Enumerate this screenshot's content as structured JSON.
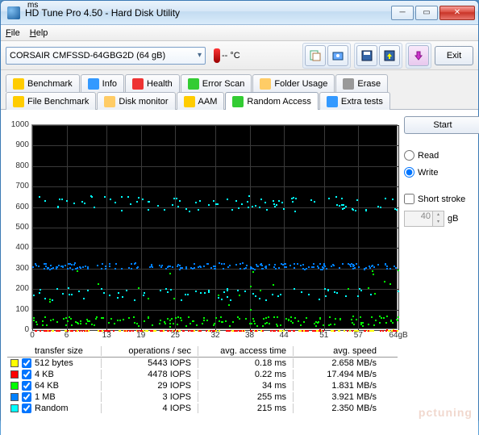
{
  "window": {
    "title": "HD Tune Pro 4.50 - Hard Disk Utility"
  },
  "menu": {
    "file": "File",
    "help": "Help"
  },
  "toolbar": {
    "device": "CORSAIR CMFSSD-64GBG2D (64 gB)",
    "temp_label": "-- °C",
    "exit": "Exit"
  },
  "tabs": {
    "row1": [
      "Benchmark",
      "Info",
      "Health",
      "Error Scan",
      "Folder Usage",
      "Erase"
    ],
    "row2": [
      "File Benchmark",
      "Disk monitor",
      "AAM",
      "Random Access",
      "Extra tests"
    ],
    "active": "Random Access"
  },
  "controls": {
    "start": "Start",
    "read": "Read",
    "write": "Write",
    "short_stroke": "Short stroke",
    "stroke_value": "40",
    "stroke_unit": "gB"
  },
  "chart_data": {
    "type": "scatter",
    "title": "",
    "xlabel": "gB",
    "ylabel": "ms",
    "xlim": [
      0,
      64
    ],
    "ylim": [
      0,
      1000
    ],
    "xticks": [
      0,
      6,
      13,
      19,
      25,
      32,
      38,
      44,
      51,
      57,
      "64gB"
    ],
    "yticks": [
      0,
      100,
      200,
      300,
      400,
      500,
      600,
      700,
      800,
      900,
      1000
    ],
    "series": [
      {
        "name": "512 bytes",
        "color": "#ffff00",
        "band_ms": [
          0,
          2
        ]
      },
      {
        "name": "4 KB",
        "color": "#ff0000",
        "band_ms": [
          0,
          2
        ]
      },
      {
        "name": "64 KB",
        "color": "#00ff00",
        "band_ms": [
          20,
          70
        ]
      },
      {
        "name": "1 MB",
        "color": "#0080ff",
        "band_ms": [
          300,
          330
        ]
      },
      {
        "name": "Random",
        "color": "#00ffff",
        "band_ms": [
          150,
          640
        ]
      }
    ]
  },
  "table": {
    "headers": {
      "size": "transfer size",
      "ops": "operations / sec",
      "time": "avg. access time",
      "speed": "avg. speed"
    },
    "rows": [
      {
        "color": "#ffff00",
        "size": "512 bytes",
        "ops": "5443 IOPS",
        "time": "0.18 ms",
        "speed": "2.658 MB/s"
      },
      {
        "color": "#ff0000",
        "size": "4 KB",
        "ops": "4478 IOPS",
        "time": "0.22 ms",
        "speed": "17.494 MB/s"
      },
      {
        "color": "#00ff00",
        "size": "64 KB",
        "ops": "29 IOPS",
        "time": "34 ms",
        "speed": "1.831 MB/s"
      },
      {
        "color": "#0080ff",
        "size": "1 MB",
        "ops": "3 IOPS",
        "time": "255 ms",
        "speed": "3.921 MB/s"
      },
      {
        "color": "#00ffff",
        "size": "Random",
        "ops": "4 IOPS",
        "time": "215 ms",
        "speed": "2.350 MB/s"
      }
    ]
  },
  "watermark": "pctuning"
}
